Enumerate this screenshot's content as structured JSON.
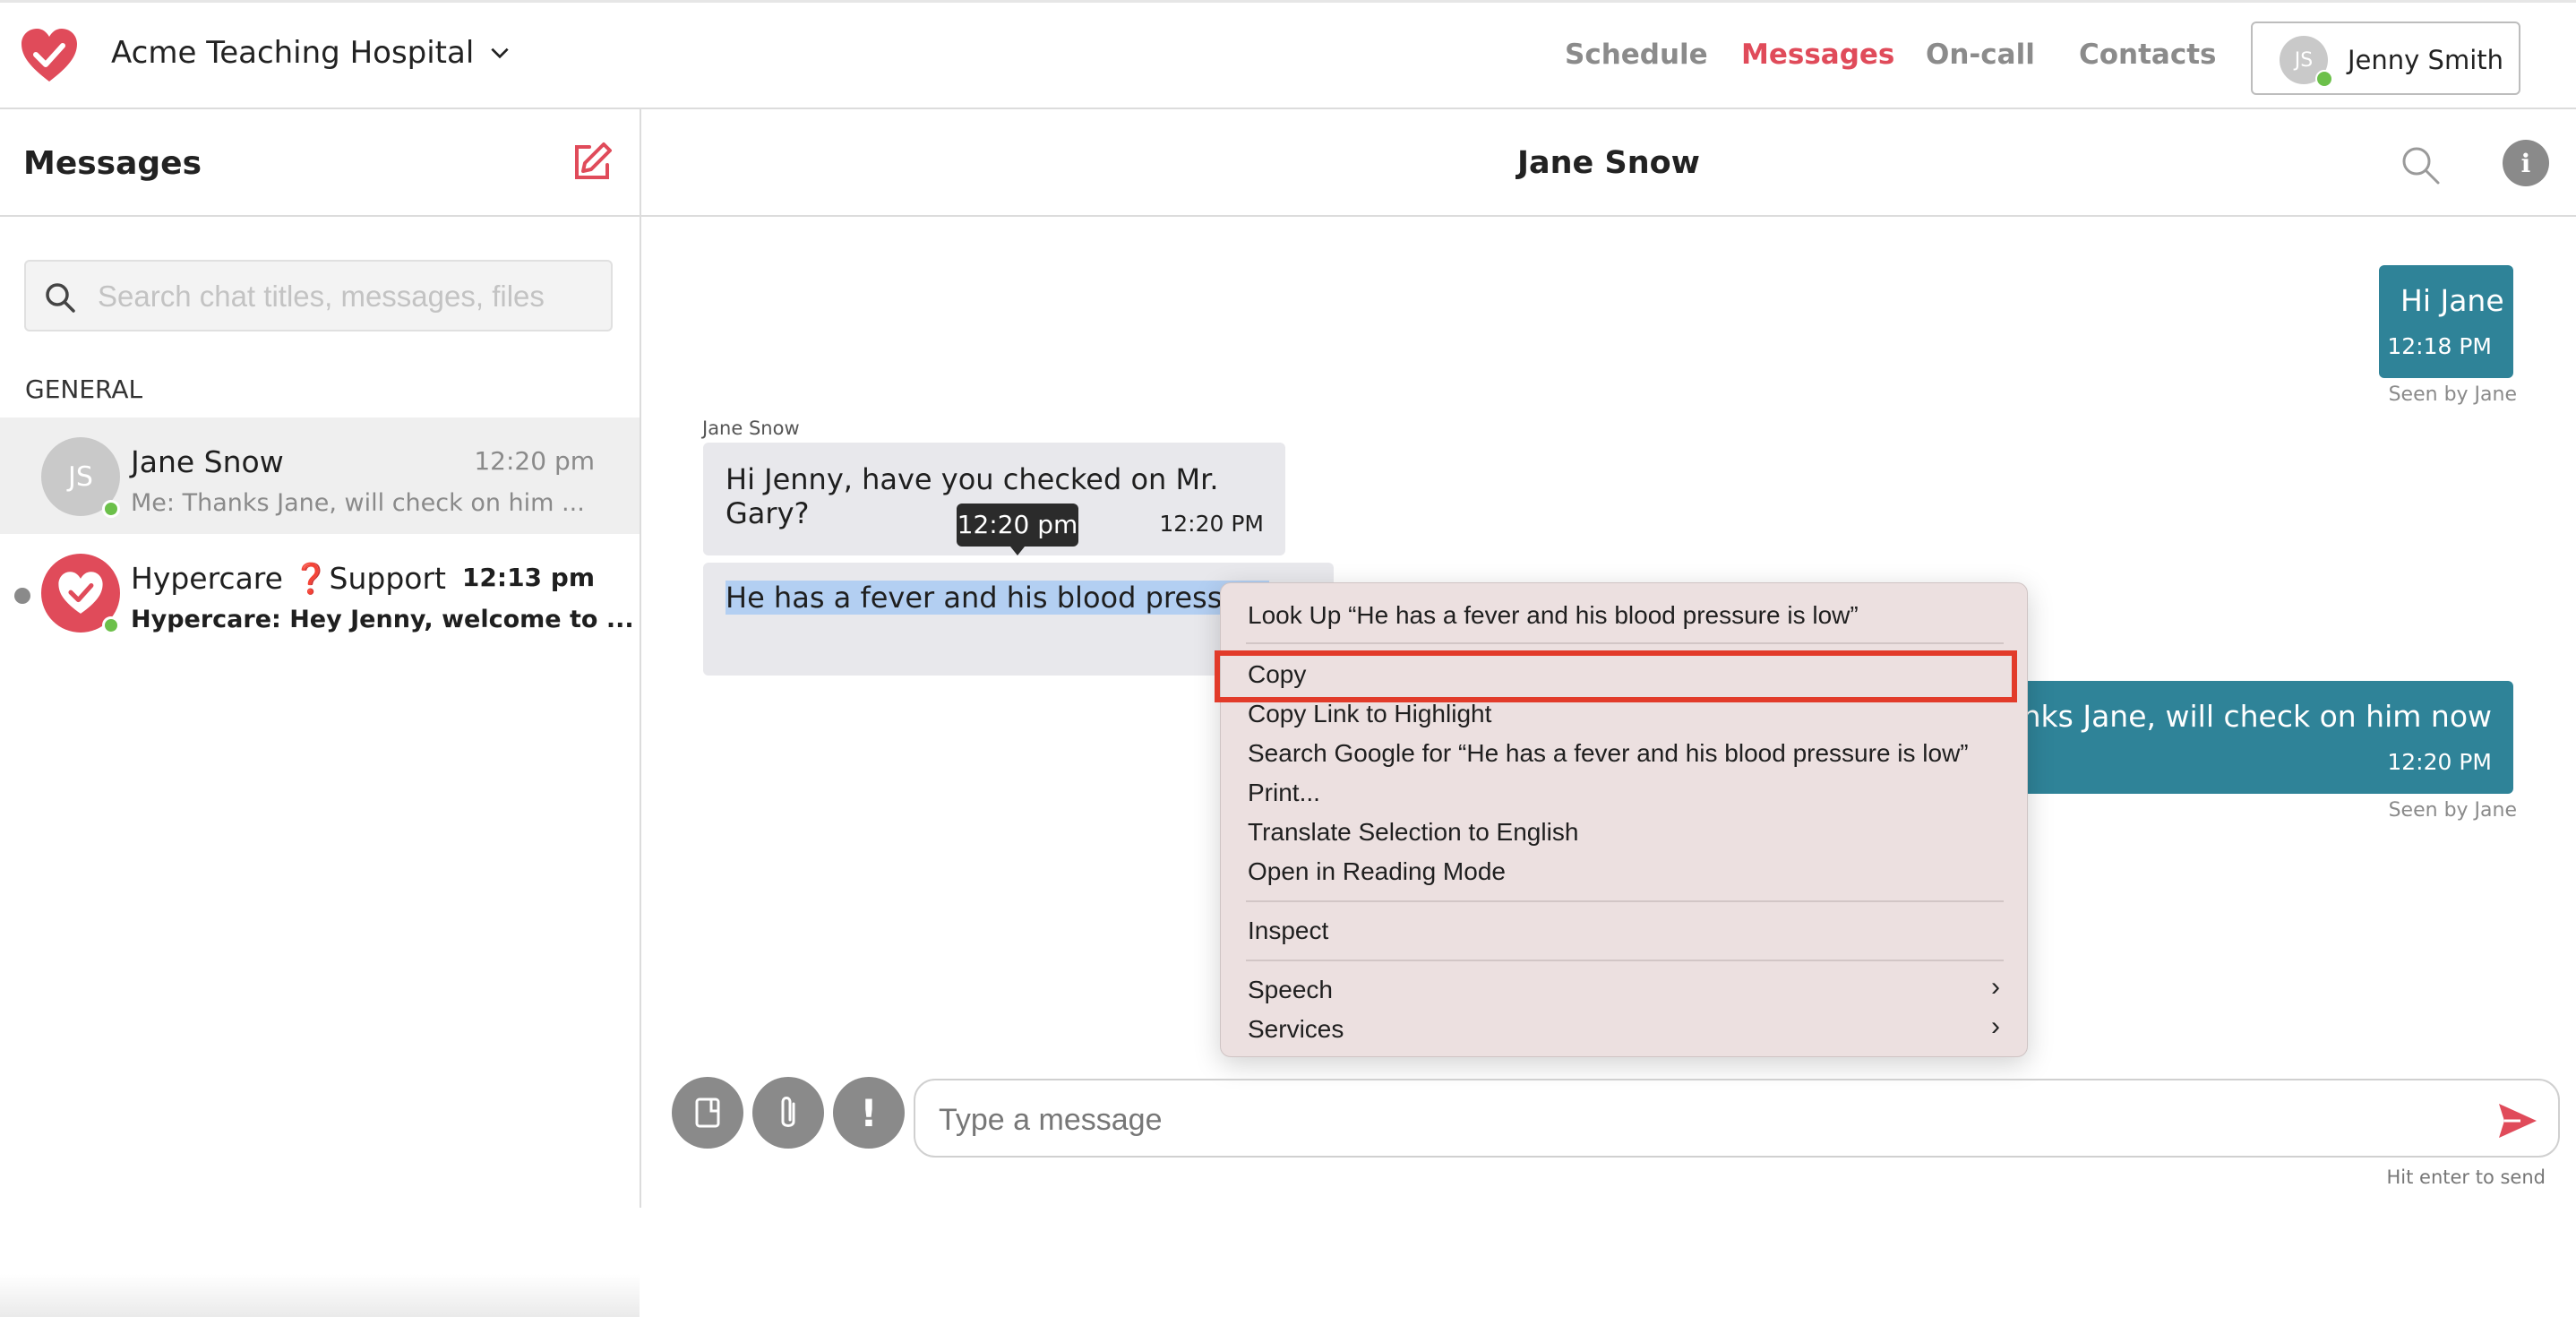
{
  "header": {
    "hospital_name": "Acme Teaching Hospital",
    "nav": [
      "Schedule",
      "Messages",
      "On-call",
      "Contacts"
    ],
    "active_nav": "Messages",
    "user": {
      "initials": "JS",
      "name": "Jenny Smith"
    }
  },
  "sidebar": {
    "title": "Messages",
    "search_placeholder": "Search chat titles, messages, files",
    "section_label": "GENERAL",
    "chats": [
      {
        "initials": "JS",
        "name": "Jane Snow",
        "time": "12:20 pm",
        "preview": "Me: Thanks Jane, will check on him ..."
      },
      {
        "name_prefix": "Hypercare",
        "name_icon": "❓",
        "name_suffix": "Support",
        "time": "12:13 pm",
        "preview": "Hypercare: Hey Jenny, welcome to ..."
      }
    ]
  },
  "conversation": {
    "title": "Jane Snow",
    "messages": [
      {
        "text": "Hi Jane",
        "time": "12:18 PM",
        "seen": "Seen by Jane"
      },
      {
        "sender": "Jane Snow",
        "text": "Hi Jenny, have you checked on Mr. Gary?",
        "time": "12:20 PM"
      },
      {
        "text": "He has a fever and his blood pressure",
        "tooltip": "12:20 pm"
      },
      {
        "text": "Thanks Jane, will check on him now",
        "time": "12:20 PM",
        "seen": "Seen by Jane"
      }
    ]
  },
  "context_menu": {
    "items": [
      "Look Up “He has a fever and his blood pressure is low”",
      "Copy",
      "Copy Link to Highlight",
      "Search Google for “He has a fever and his blood pressure is low”",
      "Print...",
      "Translate Selection to English",
      "Open in Reading Mode",
      "Inspect",
      "Speech",
      "Services"
    ],
    "highlighted": "Copy"
  },
  "composer": {
    "placeholder": "Type a message",
    "hint": "Hit enter to send"
  },
  "colors": {
    "brand": "#e04b5a",
    "outgoing_bubble": "#2f8398",
    "incoming_bubble": "#e8e8ec",
    "online": "#6cc04a",
    "highlight_box": "#e23b2a"
  }
}
